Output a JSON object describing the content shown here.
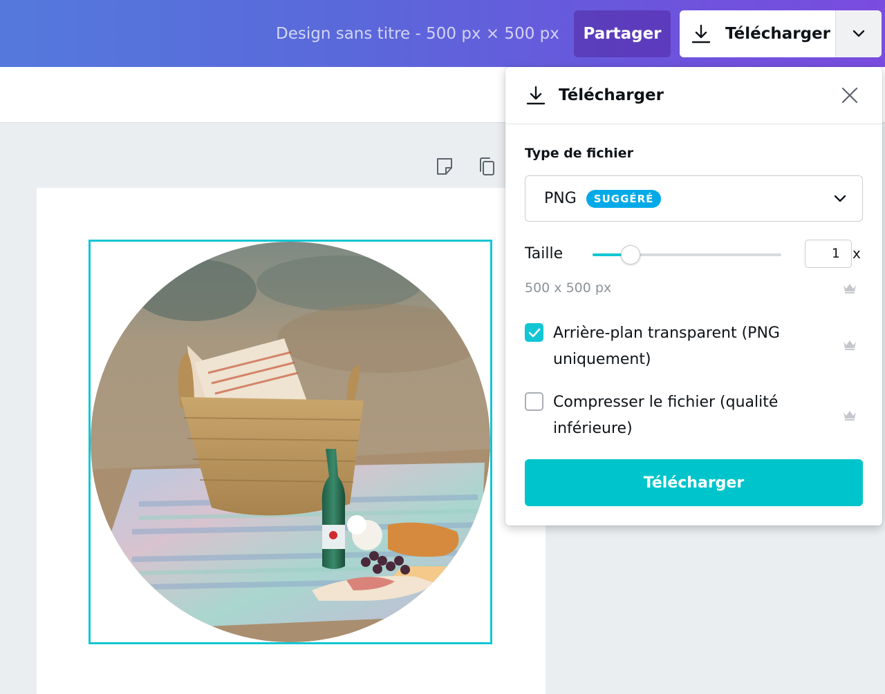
{
  "header": {
    "design_title": "Design sans titre - 500 px × 500 px",
    "share_label": "Partager",
    "download_label": "Télécharger"
  },
  "canvas": {
    "photo_description": "picnic basket with bottle and food on striped blanket"
  },
  "panel": {
    "title": "Télécharger",
    "file_type_label": "Type de fichier",
    "file_type_value": "PNG",
    "file_type_badge": "SUGGÉRÉ",
    "size_label": "Taille",
    "size_value": "1",
    "size_unit": "x",
    "size_slider_fraction": 0.2,
    "dimensions": "500 x 500 px",
    "transparent_bg_label": "Arrière-plan transparent (PNG uniquement)",
    "transparent_bg_checked": true,
    "compress_label": "Compresser le fichier (qualité inférieure)",
    "compress_checked": false,
    "download_button_label": "Télécharger"
  },
  "colors": {
    "accent": "#00c4cc",
    "selection": "#12c6d4",
    "badge": "#04a9e7",
    "header_start": "#5479dc",
    "header_end": "#7a4cdf"
  }
}
